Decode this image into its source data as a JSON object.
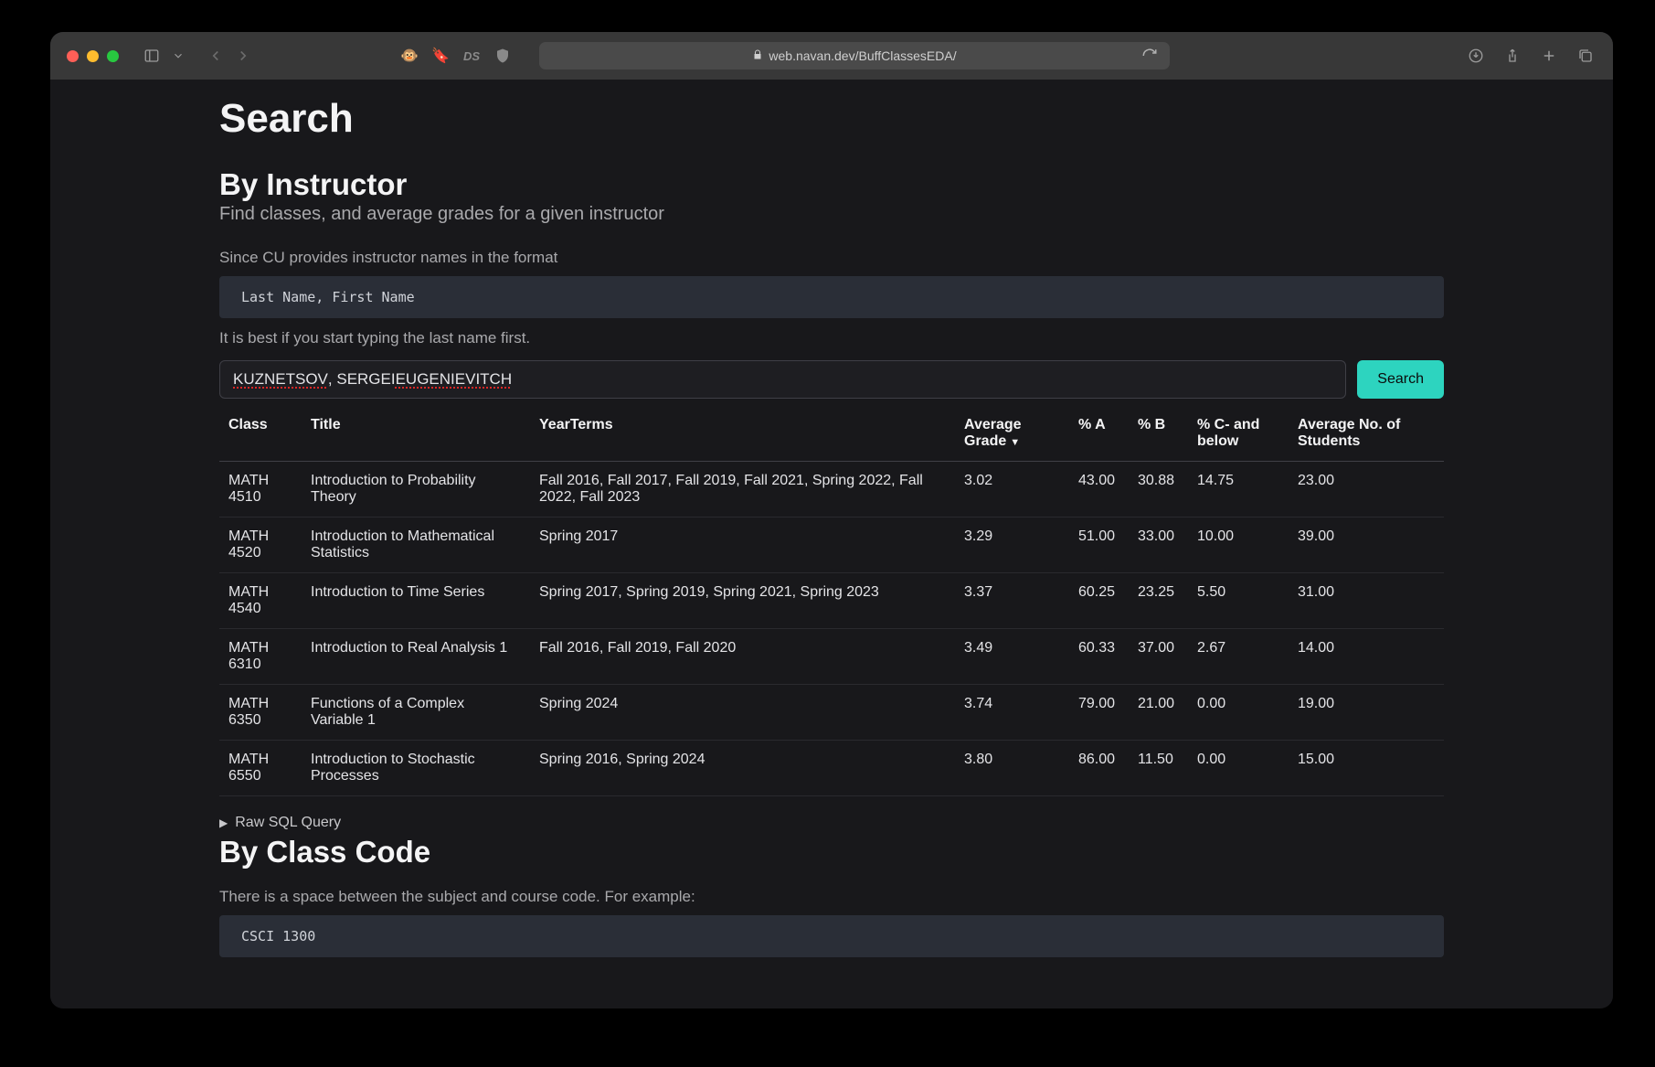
{
  "browser": {
    "url": "web.navan.dev/BuffClassesEDA/"
  },
  "page": {
    "title": "Search"
  },
  "instructor_section": {
    "heading": "By Instructor",
    "subtitle": "Find classes, and average grades for a given instructor",
    "note_before": "Since CU provides instructor names in the format",
    "format_example": "Last Name, First Name",
    "note_after": "It is best if you start typing the last name first.",
    "input_value_parts": [
      "KUZNETSOV",
      ", SERGEI ",
      "EUGENIEVITCH"
    ],
    "search_label": "Search"
  },
  "table": {
    "headers": {
      "class": "Class",
      "title": "Title",
      "terms": "YearTerms",
      "avg_grade": "Average Grade",
      "pct_a": "% A",
      "pct_b": "% B",
      "pct_c": "% C- and below",
      "avg_students": "Average No. of Students"
    },
    "rows": [
      {
        "class": "MATH 4510",
        "title": "Introduction to Probability Theory",
        "terms": "Fall 2016, Fall 2017, Fall 2019, Fall 2021, Spring 2022, Fall 2022, Fall 2023",
        "avg": "3.02",
        "a": "43.00",
        "b": "30.88",
        "c": "14.75",
        "students": "23.00"
      },
      {
        "class": "MATH 4520",
        "title": "Introduction to Mathematical Statistics",
        "terms": "Spring 2017",
        "avg": "3.29",
        "a": "51.00",
        "b": "33.00",
        "c": "10.00",
        "students": "39.00"
      },
      {
        "class": "MATH 4540",
        "title": "Introduction to Time Series",
        "terms": "Spring 2017, Spring 2019, Spring 2021, Spring 2023",
        "avg": "3.37",
        "a": "60.25",
        "b": "23.25",
        "c": "5.50",
        "students": "31.00"
      },
      {
        "class": "MATH 6310",
        "title": "Introduction to Real Analysis 1",
        "terms": "Fall 2016, Fall 2019, Fall 2020",
        "avg": "3.49",
        "a": "60.33",
        "b": "37.00",
        "c": "2.67",
        "students": "14.00"
      },
      {
        "class": "MATH 6350",
        "title": "Functions of a Complex Variable 1",
        "terms": "Spring 2024",
        "avg": "3.74",
        "a": "79.00",
        "b": "21.00",
        "c": "0.00",
        "students": "19.00"
      },
      {
        "class": "MATH 6550",
        "title": "Introduction to Stochastic Processes",
        "terms": "Spring 2016, Spring 2024",
        "avg": "3.80",
        "a": "86.00",
        "b": "11.50",
        "c": "0.00",
        "students": "15.00"
      }
    ]
  },
  "disclosure": {
    "label": "Raw SQL Query"
  },
  "code_section": {
    "heading": "By Class Code",
    "note": "There is a space between the subject and course code. For example:",
    "example": "CSCI 1300"
  }
}
